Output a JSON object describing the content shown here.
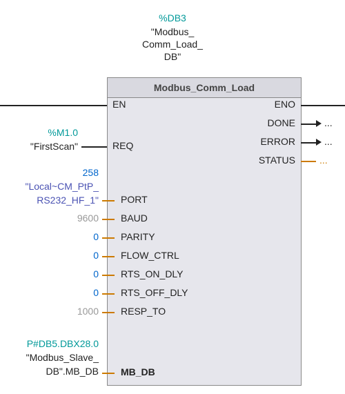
{
  "header": {
    "db_id": "%DB3",
    "db_name_line1": "\"Modbus_",
    "db_name_line2": "Comm_Load_",
    "db_name_line3": "DB\""
  },
  "block": {
    "title": "Modbus_Comm_Load"
  },
  "inputs": {
    "en": {
      "pin": "EN"
    },
    "req": {
      "pin": "REQ",
      "addr": "%M1.0",
      "symbol": "\"FirstScan\""
    },
    "port": {
      "pin": "PORT",
      "value": "258",
      "symbol1": "\"Local~CM_PtP_",
      "symbol2": "RS232_HF_1\""
    },
    "baud": {
      "pin": "BAUD",
      "value": "9600"
    },
    "parity": {
      "pin": "PARITY",
      "value": "0"
    },
    "flow_ctrl": {
      "pin": "FLOW_CTRL",
      "value": "0"
    },
    "rts_on_dly": {
      "pin": "RTS_ON_DLY",
      "value": "0"
    },
    "rts_off_dly": {
      "pin": "RTS_OFF_DLY",
      "value": "0"
    },
    "resp_to": {
      "pin": "RESP_TO",
      "value": "1000"
    },
    "mb_db": {
      "pin": "MB_DB",
      "addr": "P#DB5.DBX28.0",
      "symbol1": "\"Modbus_Slave_",
      "symbol2": "DB\".MB_DB"
    }
  },
  "outputs": {
    "eno": {
      "pin": "ENO"
    },
    "done": {
      "pin": "DONE",
      "stub": "..."
    },
    "error": {
      "pin": "ERROR",
      "stub": "..."
    },
    "status": {
      "pin": "STATUS",
      "stub": "..."
    }
  }
}
